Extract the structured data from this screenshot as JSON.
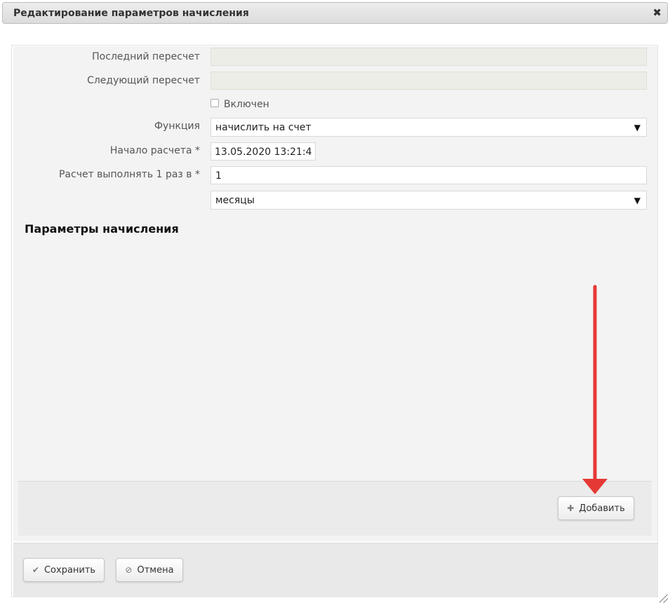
{
  "dialog": {
    "title": "Редактирование параметров начисления",
    "close_icon": "close-icon"
  },
  "form": {
    "last_recalc_label": "Последний пересчет",
    "last_recalc_value": "",
    "next_recalc_label": "Следующий пересчет",
    "next_recalc_value": "",
    "enabled_label": "Включен",
    "enabled_checked": false,
    "function_label": "Функция",
    "function_value": "начислить на счет",
    "start_label": "Начало расчета *",
    "start_value": "13.05.2020 13:21:4",
    "period_label": "Расчет выполнять 1 раз в *",
    "period_value": "1",
    "unit_value": "месяцы"
  },
  "section": {
    "title": "Параметры начисления",
    "add_label": "Добавить",
    "add_icon": "plus-icon"
  },
  "footer": {
    "save_label": "Сохранить",
    "save_icon": "check-icon",
    "cancel_label": "Отмена",
    "cancel_icon": "cancel-icon"
  },
  "annotation": {
    "arrow_color": "#e53935",
    "arrow_icon": "red-arrow-icon"
  }
}
